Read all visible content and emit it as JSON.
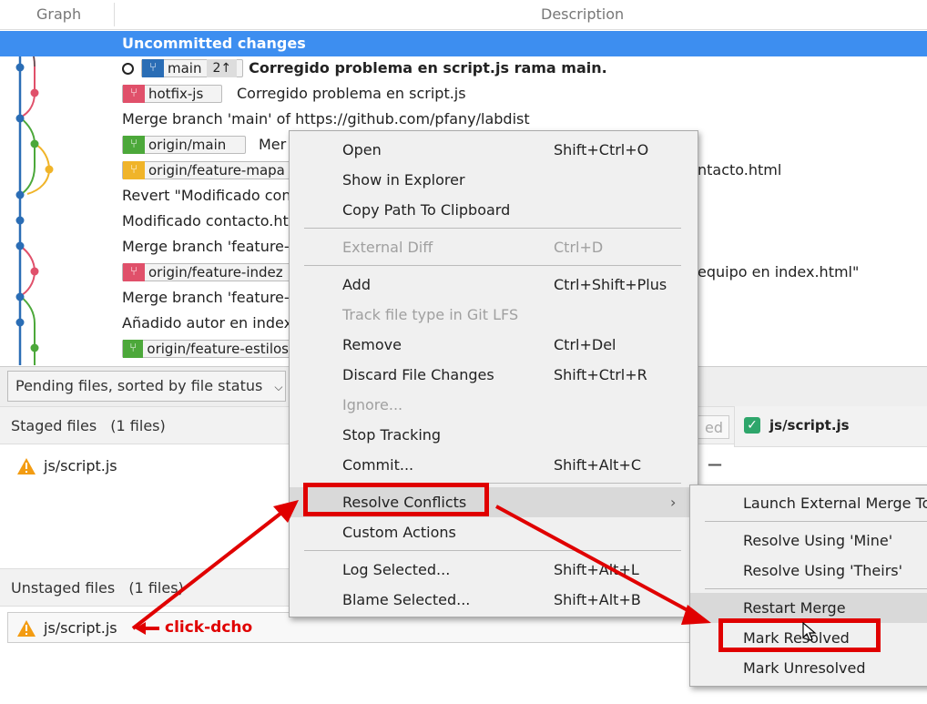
{
  "header": {
    "graph_col": "Graph",
    "description_col": "Description"
  },
  "commits": [
    {
      "text": "Uncommitted changes",
      "bold": true
    },
    {
      "branch": "main",
      "count": "2↑",
      "text": "Corregido problema en script.js rama main.",
      "bold": true
    },
    {
      "branch": "hotfix-js",
      "text": "Corregido problema en script.js"
    },
    {
      "text": "Merge branch 'main' of https://github.com/pfany/labdist"
    },
    {
      "branch": "origin/main",
      "text": "Mer"
    },
    {
      "branch": "origin/feature-mapa",
      "text": "ntacto.html"
    },
    {
      "text": "Revert \"Modificado con"
    },
    {
      "text": "Modificado contacto.ht"
    },
    {
      "text": "Merge branch 'feature-"
    },
    {
      "branch": "origin/feature-indez",
      "text": "equipo en index.html\""
    },
    {
      "text": "Merge branch 'feature-"
    },
    {
      "text": "Añadido autor en index"
    },
    {
      "branch": "origin/feature-estilos",
      "text": ""
    }
  ],
  "pending": {
    "sort_label": "Pending files, sorted by file status",
    "staged_title": "Staged files",
    "staged_count": "(1 files)",
    "staged_files": [
      "js/script.js"
    ],
    "unstaged_title": "Unstaged files",
    "unstaged_count": "(1 files)",
    "unstaged_files": [
      "js/script.js"
    ],
    "partial_label": "ed",
    "diff_file": "js/script.js"
  },
  "context_menu": {
    "items": [
      {
        "label": "Open",
        "shortcut": "Shift+Ctrl+O"
      },
      {
        "label": "Show in Explorer",
        "shortcut": ""
      },
      {
        "label": "Copy Path To Clipboard",
        "shortcut": ""
      },
      {
        "label": "External Diff",
        "shortcut": "Ctrl+D",
        "disabled": true
      },
      {
        "label": "Add",
        "shortcut": "Ctrl+Shift+Plus"
      },
      {
        "label": "Track file type in Git LFS",
        "shortcut": "",
        "disabled": true
      },
      {
        "label": "Remove",
        "shortcut": "Ctrl+Del"
      },
      {
        "label": "Discard File Changes",
        "shortcut": "Shift+Ctrl+R"
      },
      {
        "label": "Ignore...",
        "shortcut": "",
        "disabled": true
      },
      {
        "label": "Stop Tracking",
        "shortcut": ""
      },
      {
        "label": "Commit...",
        "shortcut": "Shift+Alt+C"
      },
      {
        "label": "Resolve Conflicts",
        "shortcut": ""
      },
      {
        "label": "Custom Actions",
        "shortcut": ""
      },
      {
        "label": "Log Selected...",
        "shortcut": "Shift+Alt+L"
      },
      {
        "label": "Blame Selected...",
        "shortcut": "Shift+Alt+B"
      }
    ]
  },
  "submenu": {
    "items": [
      {
        "label": "Launch External Merge To"
      },
      {
        "label": "Resolve Using 'Mine'"
      },
      {
        "label": "Resolve Using 'Theirs'"
      },
      {
        "label": "Restart Merge"
      },
      {
        "label": "Mark Resolved"
      },
      {
        "label": "Mark Unresolved"
      }
    ]
  },
  "annotation": "click-dcho",
  "colors": {
    "selection": "#3d8ef0",
    "annotation_red": "#e00000",
    "lane_blue": "#2a6db5",
    "lane_pink": "#e0506a",
    "lane_green": "#4ca83a",
    "lane_yellow": "#f0b429"
  }
}
